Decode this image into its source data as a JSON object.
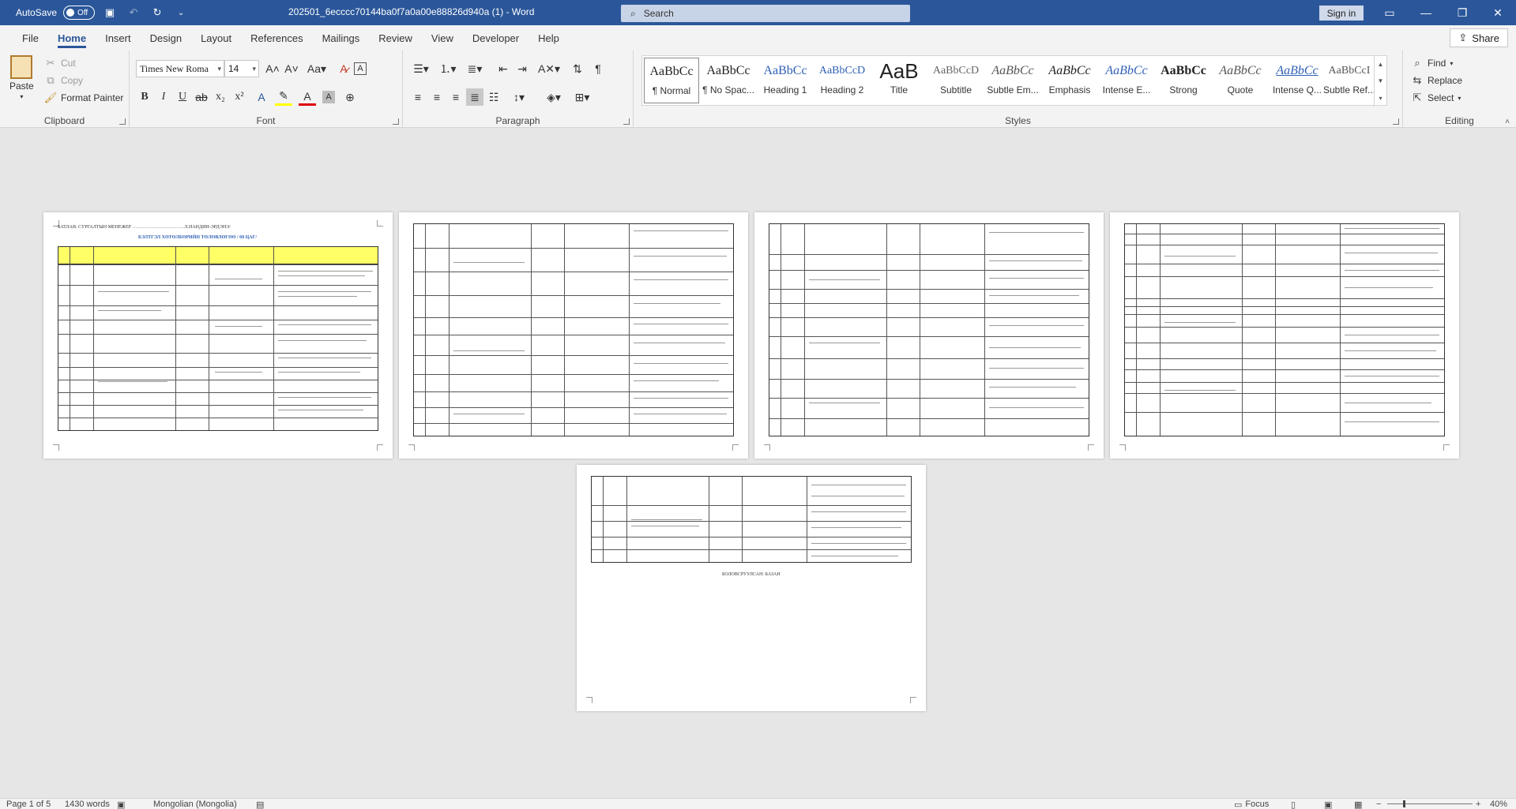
{
  "titlebar": {
    "autosave_label": "AutoSave",
    "autosave_state": "Off",
    "doc_title": "202501_6ecccc70144ba0f7a0a00e88826d940a (1)  -  Word",
    "search_placeholder": "Search",
    "signin_label": "Sign in"
  },
  "menu": {
    "tabs": [
      "File",
      "Home",
      "Insert",
      "Design",
      "Layout",
      "References",
      "Mailings",
      "Review",
      "View",
      "Developer",
      "Help"
    ],
    "active": "Home",
    "share_label": "Share"
  },
  "ribbon": {
    "clipboard": {
      "label": "Clipboard",
      "paste": "Paste",
      "cut": "Cut",
      "copy": "Copy",
      "format_painter": "Format Painter"
    },
    "font": {
      "label": "Font",
      "font_name": "Times New Roma",
      "font_size": "14"
    },
    "paragraph": {
      "label": "Paragraph"
    },
    "styles": {
      "label": "Styles",
      "items": [
        {
          "preview": "AaBbCc",
          "name": "¶ Normal"
        },
        {
          "preview": "AaBbCc",
          "name": "¶ No Spac..."
        },
        {
          "preview": "AaBbCc",
          "name": "Heading 1"
        },
        {
          "preview": "AaBbCcD",
          "name": "Heading 2"
        },
        {
          "preview": "AaB",
          "name": "Title"
        },
        {
          "preview": "AaBbCcD",
          "name": "Subtitle"
        },
        {
          "preview": "AaBbCc",
          "name": "Subtle Em..."
        },
        {
          "preview": "AaBbCc",
          "name": "Emphasis"
        },
        {
          "preview": "AaBbCc",
          "name": "Intense E..."
        },
        {
          "preview": "AaBbCc",
          "name": "Strong"
        },
        {
          "preview": "AaBbCc",
          "name": "Quote"
        },
        {
          "preview": "AaBbCc",
          "name": "Intense Q..."
        },
        {
          "preview": "AaBbCcI",
          "name": "Subtle Ref..."
        }
      ]
    },
    "editing": {
      "label": "Editing",
      "find": "Find",
      "replace": "Replace",
      "select": "Select"
    }
  },
  "document": {
    "page1_header": "БАТЛАВ: СУРГАЛТЫН МЕНЕЖЕР ……………………………Л.НАНДИН-ЭРДЭНЭ/",
    "page1_title": "БЭЛТГЭЛ ХӨТӨЛБӨРИЙН ТӨЛӨВЛӨГӨӨ / 60 ЦАГ/",
    "page5_footer": "БОЛОВСРУУЛСАН: БАЗАН"
  },
  "statusbar": {
    "page": "Page 1 of 5",
    "words": "1430 words",
    "language": "Mongolian (Mongolia)",
    "focus": "Focus",
    "zoom": "40%"
  },
  "colors": {
    "accent": "#2b579a",
    "table_header": "#ffff66",
    "title_blue": "#2f5fb5"
  }
}
